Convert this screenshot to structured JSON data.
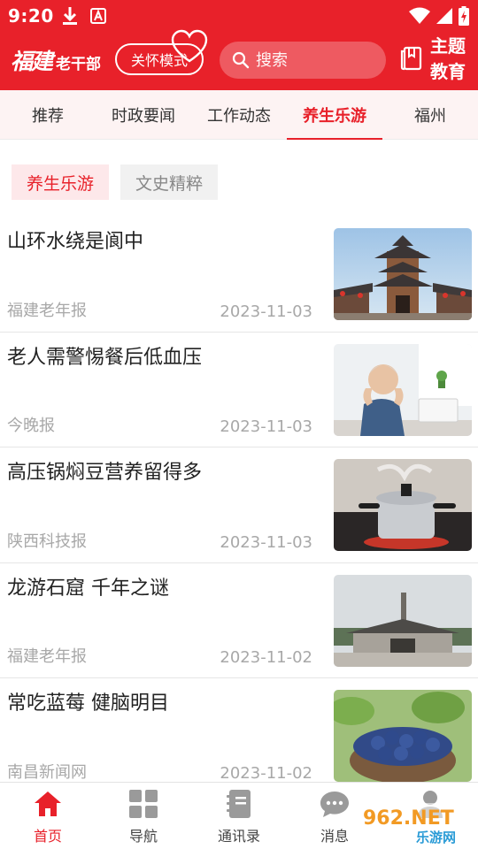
{
  "status": {
    "time": "9:20"
  },
  "header": {
    "logo_brush": "福建",
    "logo_sub": "老干部",
    "care_mode": "关怀模式",
    "search_placeholder": "搜索",
    "theme_line1": "主题",
    "theme_line2": "教育"
  },
  "tabs": [
    "推荐",
    "时政要闻",
    "工作动态",
    "养生乐游",
    "福州"
  ],
  "active_tab": "养生乐游",
  "sub_tags": [
    "养生乐游",
    "文史精粹"
  ],
  "news": [
    {
      "title": "山环水绕是阆中",
      "source": "福建老年报",
      "date": "2023-11-03"
    },
    {
      "title": "老人需警惕餐后低血压",
      "source": "今晚报",
      "date": "2023-11-03"
    },
    {
      "title": "高压锅焖豆营养留得多",
      "source": "陕西科技报",
      "date": "2023-11-03"
    },
    {
      "title": "龙游石窟 千年之谜",
      "source": "福建老年报",
      "date": "2023-11-02"
    },
    {
      "title": "常吃蓝莓 健脑明目",
      "source": "南昌新闻网",
      "date": "2023-11-02"
    }
  ],
  "bottom_nav": [
    "首页",
    "导航",
    "通讯录",
    "消息",
    ""
  ],
  "watermark": {
    "main": "962.NET",
    "sub": "乐游网"
  },
  "icons": {
    "care_mode": "heart-icon",
    "search": "search-icon",
    "theme": "book-icon",
    "nav": [
      "home-icon",
      "grid-icon",
      "contacts-book-icon",
      "chat-bubble-icon",
      "user-icon"
    ]
  },
  "colors": {
    "brand_red": "#e8212a",
    "tab_bg": "#fdf3f3",
    "tag_bg": "#fde8ea",
    "muted": "#a8a8a8"
  }
}
